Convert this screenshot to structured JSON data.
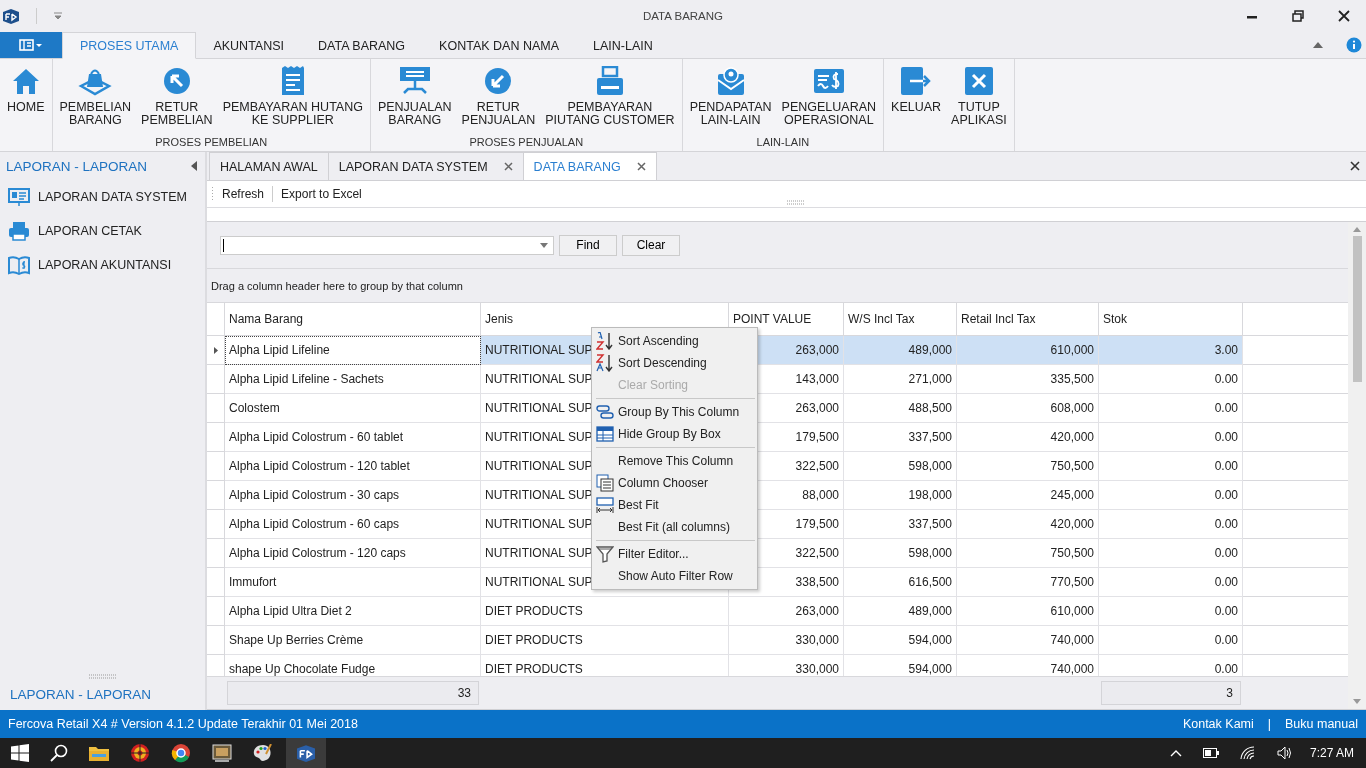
{
  "window": {
    "title": "DATA BARANG"
  },
  "ribbon": {
    "tabs": [
      {
        "label": "PROSES UTAMA",
        "selected": true
      },
      {
        "label": "AKUNTANSI",
        "selected": false
      },
      {
        "label": "DATA BARANG",
        "selected": false
      },
      {
        "label": "KONTAK DAN NAMA",
        "selected": false
      },
      {
        "label": "LAIN-LAIN",
        "selected": false
      }
    ],
    "groups": [
      {
        "items": [
          "HOME"
        ]
      },
      {
        "title": "PROSES PEMBELIAN",
        "items": [
          "PEMBELIAN\nBARANG",
          "RETUR\nPEMBELIAN",
          "PEMBAYARAN HUTANG\nKE SUPPLIER"
        ]
      },
      {
        "title": "PROSES PENJUALAN",
        "items": [
          "PENJUALAN\nBARANG",
          "RETUR\nPENJUALAN",
          "PEMBAYARAN\nPIUTANG CUSTOMER"
        ]
      },
      {
        "title": "LAIN-LAIN",
        "items": [
          "PENDAPATAN\nLAIN-LAIN",
          "PENGELUARAN\nOPERASIONAL"
        ]
      },
      {
        "items": [
          "KELUAR",
          "TUTUP\nAPLIKASI"
        ]
      }
    ]
  },
  "sidebar": {
    "title": "LAPORAN - LAPORAN",
    "items": [
      "LAPORAN DATA SYSTEM",
      "LAPORAN CETAK",
      "LAPORAN AKUNTANSI"
    ],
    "footer": "LAPORAN - LAPORAN"
  },
  "doc_tabs": [
    {
      "label": "HALAMAN AWAL",
      "selected": false,
      "closable": false
    },
    {
      "label": "LAPORAN DATA SYSTEM",
      "selected": false,
      "closable": true
    },
    {
      "label": "DATA BARANG",
      "selected": true,
      "closable": true
    }
  ],
  "toolbar": [
    "Refresh",
    "Export to Excel"
  ],
  "find": {
    "find_button": "Find",
    "clear_button": "Clear"
  },
  "group_panel": "Drag a column header here to group by that column",
  "table": {
    "columns": [
      "Nama Barang",
      "Jenis",
      "POINT VALUE",
      "W/S Incl Tax",
      "Retail Incl Tax",
      "Stok"
    ],
    "rows": [
      {
        "selected": true,
        "cells": [
          "Alpha Lipid Lifeline",
          "NUTRITIONAL SUP",
          "263,000",
          "489,000",
          "610,000",
          "3.00"
        ]
      },
      {
        "selected": false,
        "cells": [
          "Alpha Lipid Lifeline - Sachets",
          "NUTRITIONAL SUP",
          "143,000",
          "271,000",
          "335,500",
          "0.00"
        ]
      },
      {
        "selected": false,
        "cells": [
          "Colostem",
          "NUTRITIONAL SUP",
          "263,000",
          "488,500",
          "608,000",
          "0.00"
        ]
      },
      {
        "selected": false,
        "cells": [
          "Alpha Lipid Colostrum - 60 tablet",
          "NUTRITIONAL SUP",
          "179,500",
          "337,500",
          "420,000",
          "0.00"
        ]
      },
      {
        "selected": false,
        "cells": [
          "Alpha Lipid Colostrum - 120 tablet",
          "NUTRITIONAL SUP",
          "322,500",
          "598,000",
          "750,500",
          "0.00"
        ]
      },
      {
        "selected": false,
        "cells": [
          "Alpha Lipid Colostrum - 30 caps",
          "NUTRITIONAL SUP",
          "88,000",
          "198,000",
          "245,000",
          "0.00"
        ]
      },
      {
        "selected": false,
        "cells": [
          "Alpha Lipid Colostrum - 60 caps",
          "NUTRITIONAL SUP",
          "179,500",
          "337,500",
          "420,000",
          "0.00"
        ]
      },
      {
        "selected": false,
        "cells": [
          "Alpha Lipid Colostrum - 120 caps",
          "NUTRITIONAL SUP",
          "322,500",
          "598,000",
          "750,500",
          "0.00"
        ]
      },
      {
        "selected": false,
        "cells": [
          "Immufort",
          "NUTRITIONAL SUP",
          "338,500",
          "616,500",
          "770,500",
          "0.00"
        ]
      },
      {
        "selected": false,
        "cells": [
          "Alpha Lipid Ultra Diet 2",
          "DIET PRODUCTS",
          "263,000",
          "489,000",
          "610,000",
          "0.00"
        ]
      },
      {
        "selected": false,
        "cells": [
          "Shape Up Berries Crème",
          "DIET PRODUCTS",
          "330,000",
          "594,000",
          "740,000",
          "0.00"
        ]
      },
      {
        "selected": false,
        "cells": [
          "shape Up Chocolate Fudge",
          "DIET PRODUCTS",
          "330,000",
          "594,000",
          "740,000",
          "0.00"
        ]
      }
    ],
    "footer": {
      "nama_barang": "33",
      "stok": "3"
    }
  },
  "context_menu": {
    "sections": [
      [
        {
          "label": "Sort Ascending",
          "disabled": false
        },
        {
          "label": "Sort Descending",
          "disabled": false
        },
        {
          "label": "Clear Sorting",
          "disabled": true
        }
      ],
      [
        {
          "label": "Group By This Column",
          "disabled": false
        },
        {
          "label": "Hide Group By Box",
          "disabled": false
        }
      ],
      [
        {
          "label": "Remove This Column",
          "disabled": false
        },
        {
          "label": "Column Chooser",
          "disabled": false
        },
        {
          "label": "Best Fit",
          "disabled": false
        },
        {
          "label": "Best Fit (all columns)",
          "disabled": false
        }
      ],
      [
        {
          "label": "Filter Editor...",
          "disabled": false
        },
        {
          "label": "Show Auto Filter Row",
          "disabled": false
        }
      ]
    ]
  },
  "status_bar": {
    "text": "Fercova Retail X4 # Version 4.1.2 Update Terakhir 01 Mei 2018",
    "links": [
      "Kontak Kami",
      "Buku manual"
    ],
    "separator": "|"
  },
  "taskbar": {
    "clock": "7:27 AM"
  }
}
